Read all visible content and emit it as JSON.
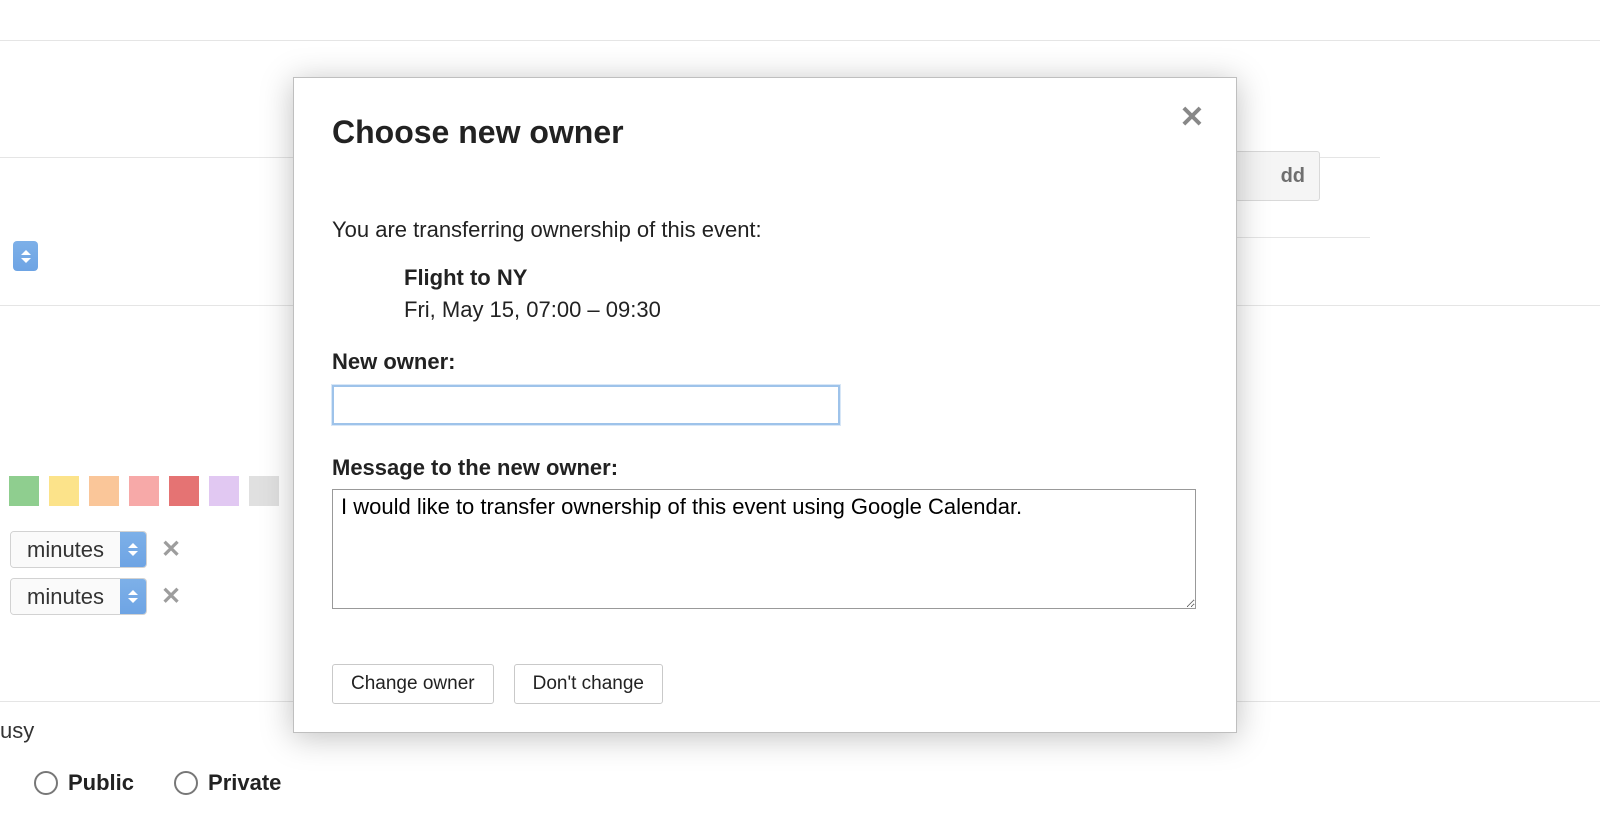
{
  "modal": {
    "title": "Choose new owner",
    "intro": "You are transferring ownership of this event:",
    "event": {
      "title": "Flight to NY",
      "time": "Fri, May 15, 07:00 – 09:30"
    },
    "owner_label": "New owner:",
    "owner_value": "",
    "message_label": "Message to the new owner:",
    "message_value": "I would like to transfer ownership of this event using Google Calendar.",
    "change_label": "Change owner",
    "cancel_label": "Don't change"
  },
  "bg": {
    "add_button_fragment": "dd",
    "color_swatches": [
      "#8fce8f",
      "#fce38a",
      "#fac699",
      "#f7a9a8",
      "#e57373",
      "#e1c8f2",
      "#e0e0e0"
    ],
    "minutes_label": "minutes",
    "busy_fragment": "usy",
    "visibility": {
      "public": "Public",
      "private": "Private"
    }
  }
}
